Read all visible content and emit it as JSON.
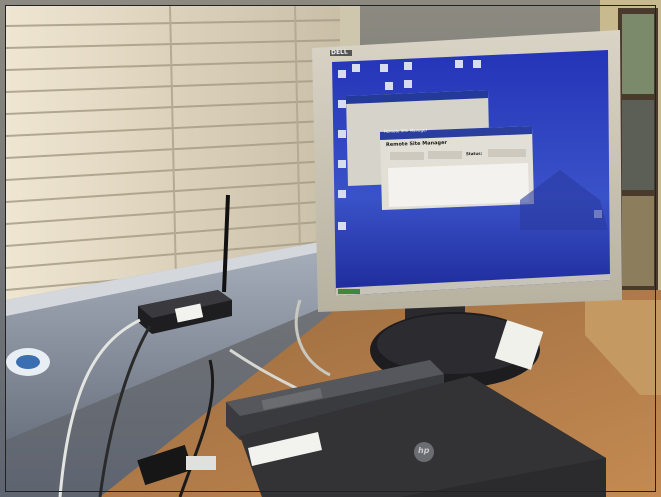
{
  "photo": {
    "subject": "Dell monitor displaying a Remote Site Manager window, with a wireless router on a window sill and HP laptops on a desk",
    "monitor_brand": "DELL",
    "laptop_brand": "hp",
    "window_dialog_title": "Remote Site Manager",
    "window_dialog_header": "Remote Site Manager",
    "window_dialog_status_label": "Status:"
  },
  "colors": {
    "desktop_blue": "#2d3fb8",
    "monitor_silver": "#c8c3b4",
    "desk_wood": "#b07a4a",
    "blinds": "#d8cfbd",
    "wall": "#6d7684",
    "laptop_black": "#2b2b2d"
  }
}
